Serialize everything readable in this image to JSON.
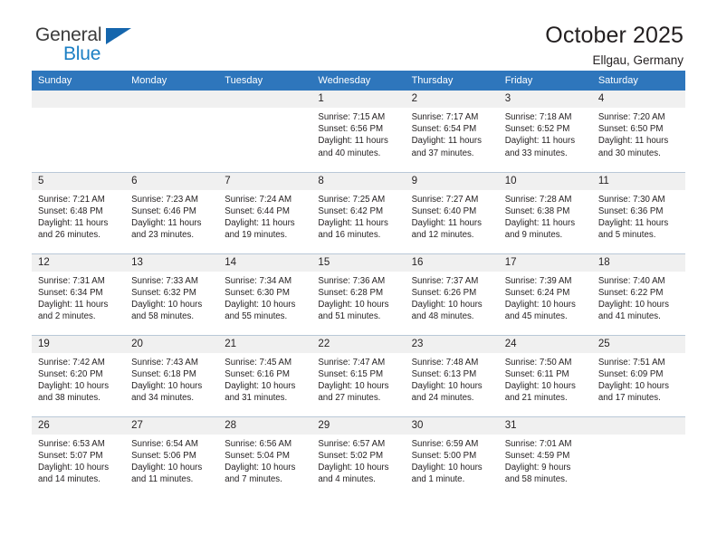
{
  "brand": {
    "name_part1": "General",
    "name_part2": "Blue",
    "triangle_color": "#1566ad",
    "blue_color": "#1b7fc4"
  },
  "header": {
    "title": "October 2025",
    "subtitle": "Ellgau, Germany",
    "header_bg": "#2e76bc",
    "daynum_bg": "#f0f0f0"
  },
  "weekdays": [
    "Sunday",
    "Monday",
    "Tuesday",
    "Wednesday",
    "Thursday",
    "Friday",
    "Saturday"
  ],
  "labels": {
    "sunrise_prefix": "Sunrise:",
    "sunset_prefix": "Sunset:",
    "daylight_prefix": "Daylight:"
  },
  "weeks": [
    [
      {
        "day": "",
        "sunrise": "",
        "sunset": "",
        "daylight_l1": "",
        "daylight_l2": ""
      },
      {
        "day": "",
        "sunrise": "",
        "sunset": "",
        "daylight_l1": "",
        "daylight_l2": ""
      },
      {
        "day": "",
        "sunrise": "",
        "sunset": "",
        "daylight_l1": "",
        "daylight_l2": ""
      },
      {
        "day": "1",
        "sunrise": "Sunrise: 7:15 AM",
        "sunset": "Sunset: 6:56 PM",
        "daylight_l1": "Daylight: 11 hours",
        "daylight_l2": "and 40 minutes."
      },
      {
        "day": "2",
        "sunrise": "Sunrise: 7:17 AM",
        "sunset": "Sunset: 6:54 PM",
        "daylight_l1": "Daylight: 11 hours",
        "daylight_l2": "and 37 minutes."
      },
      {
        "day": "3",
        "sunrise": "Sunrise: 7:18 AM",
        "sunset": "Sunset: 6:52 PM",
        "daylight_l1": "Daylight: 11 hours",
        "daylight_l2": "and 33 minutes."
      },
      {
        "day": "4",
        "sunrise": "Sunrise: 7:20 AM",
        "sunset": "Sunset: 6:50 PM",
        "daylight_l1": "Daylight: 11 hours",
        "daylight_l2": "and 30 minutes."
      }
    ],
    [
      {
        "day": "5",
        "sunrise": "Sunrise: 7:21 AM",
        "sunset": "Sunset: 6:48 PM",
        "daylight_l1": "Daylight: 11 hours",
        "daylight_l2": "and 26 minutes."
      },
      {
        "day": "6",
        "sunrise": "Sunrise: 7:23 AM",
        "sunset": "Sunset: 6:46 PM",
        "daylight_l1": "Daylight: 11 hours",
        "daylight_l2": "and 23 minutes."
      },
      {
        "day": "7",
        "sunrise": "Sunrise: 7:24 AM",
        "sunset": "Sunset: 6:44 PM",
        "daylight_l1": "Daylight: 11 hours",
        "daylight_l2": "and 19 minutes."
      },
      {
        "day": "8",
        "sunrise": "Sunrise: 7:25 AM",
        "sunset": "Sunset: 6:42 PM",
        "daylight_l1": "Daylight: 11 hours",
        "daylight_l2": "and 16 minutes."
      },
      {
        "day": "9",
        "sunrise": "Sunrise: 7:27 AM",
        "sunset": "Sunset: 6:40 PM",
        "daylight_l1": "Daylight: 11 hours",
        "daylight_l2": "and 12 minutes."
      },
      {
        "day": "10",
        "sunrise": "Sunrise: 7:28 AM",
        "sunset": "Sunset: 6:38 PM",
        "daylight_l1": "Daylight: 11 hours",
        "daylight_l2": "and 9 minutes."
      },
      {
        "day": "11",
        "sunrise": "Sunrise: 7:30 AM",
        "sunset": "Sunset: 6:36 PM",
        "daylight_l1": "Daylight: 11 hours",
        "daylight_l2": "and 5 minutes."
      }
    ],
    [
      {
        "day": "12",
        "sunrise": "Sunrise: 7:31 AM",
        "sunset": "Sunset: 6:34 PM",
        "daylight_l1": "Daylight: 11 hours",
        "daylight_l2": "and 2 minutes."
      },
      {
        "day": "13",
        "sunrise": "Sunrise: 7:33 AM",
        "sunset": "Sunset: 6:32 PM",
        "daylight_l1": "Daylight: 10 hours",
        "daylight_l2": "and 58 minutes."
      },
      {
        "day": "14",
        "sunrise": "Sunrise: 7:34 AM",
        "sunset": "Sunset: 6:30 PM",
        "daylight_l1": "Daylight: 10 hours",
        "daylight_l2": "and 55 minutes."
      },
      {
        "day": "15",
        "sunrise": "Sunrise: 7:36 AM",
        "sunset": "Sunset: 6:28 PM",
        "daylight_l1": "Daylight: 10 hours",
        "daylight_l2": "and 51 minutes."
      },
      {
        "day": "16",
        "sunrise": "Sunrise: 7:37 AM",
        "sunset": "Sunset: 6:26 PM",
        "daylight_l1": "Daylight: 10 hours",
        "daylight_l2": "and 48 minutes."
      },
      {
        "day": "17",
        "sunrise": "Sunrise: 7:39 AM",
        "sunset": "Sunset: 6:24 PM",
        "daylight_l1": "Daylight: 10 hours",
        "daylight_l2": "and 45 minutes."
      },
      {
        "day": "18",
        "sunrise": "Sunrise: 7:40 AM",
        "sunset": "Sunset: 6:22 PM",
        "daylight_l1": "Daylight: 10 hours",
        "daylight_l2": "and 41 minutes."
      }
    ],
    [
      {
        "day": "19",
        "sunrise": "Sunrise: 7:42 AM",
        "sunset": "Sunset: 6:20 PM",
        "daylight_l1": "Daylight: 10 hours",
        "daylight_l2": "and 38 minutes."
      },
      {
        "day": "20",
        "sunrise": "Sunrise: 7:43 AM",
        "sunset": "Sunset: 6:18 PM",
        "daylight_l1": "Daylight: 10 hours",
        "daylight_l2": "and 34 minutes."
      },
      {
        "day": "21",
        "sunrise": "Sunrise: 7:45 AM",
        "sunset": "Sunset: 6:16 PM",
        "daylight_l1": "Daylight: 10 hours",
        "daylight_l2": "and 31 minutes."
      },
      {
        "day": "22",
        "sunrise": "Sunrise: 7:47 AM",
        "sunset": "Sunset: 6:15 PM",
        "daylight_l1": "Daylight: 10 hours",
        "daylight_l2": "and 27 minutes."
      },
      {
        "day": "23",
        "sunrise": "Sunrise: 7:48 AM",
        "sunset": "Sunset: 6:13 PM",
        "daylight_l1": "Daylight: 10 hours",
        "daylight_l2": "and 24 minutes."
      },
      {
        "day": "24",
        "sunrise": "Sunrise: 7:50 AM",
        "sunset": "Sunset: 6:11 PM",
        "daylight_l1": "Daylight: 10 hours",
        "daylight_l2": "and 21 minutes."
      },
      {
        "day": "25",
        "sunrise": "Sunrise: 7:51 AM",
        "sunset": "Sunset: 6:09 PM",
        "daylight_l1": "Daylight: 10 hours",
        "daylight_l2": "and 17 minutes."
      }
    ],
    [
      {
        "day": "26",
        "sunrise": "Sunrise: 6:53 AM",
        "sunset": "Sunset: 5:07 PM",
        "daylight_l1": "Daylight: 10 hours",
        "daylight_l2": "and 14 minutes."
      },
      {
        "day": "27",
        "sunrise": "Sunrise: 6:54 AM",
        "sunset": "Sunset: 5:06 PM",
        "daylight_l1": "Daylight: 10 hours",
        "daylight_l2": "and 11 minutes."
      },
      {
        "day": "28",
        "sunrise": "Sunrise: 6:56 AM",
        "sunset": "Sunset: 5:04 PM",
        "daylight_l1": "Daylight: 10 hours",
        "daylight_l2": "and 7 minutes."
      },
      {
        "day": "29",
        "sunrise": "Sunrise: 6:57 AM",
        "sunset": "Sunset: 5:02 PM",
        "daylight_l1": "Daylight: 10 hours",
        "daylight_l2": "and 4 minutes."
      },
      {
        "day": "30",
        "sunrise": "Sunrise: 6:59 AM",
        "sunset": "Sunset: 5:00 PM",
        "daylight_l1": "Daylight: 10 hours",
        "daylight_l2": "and 1 minute."
      },
      {
        "day": "31",
        "sunrise": "Sunrise: 7:01 AM",
        "sunset": "Sunset: 4:59 PM",
        "daylight_l1": "Daylight: 9 hours",
        "daylight_l2": "and 58 minutes."
      },
      {
        "day": "",
        "sunrise": "",
        "sunset": "",
        "daylight_l1": "",
        "daylight_l2": ""
      }
    ]
  ]
}
